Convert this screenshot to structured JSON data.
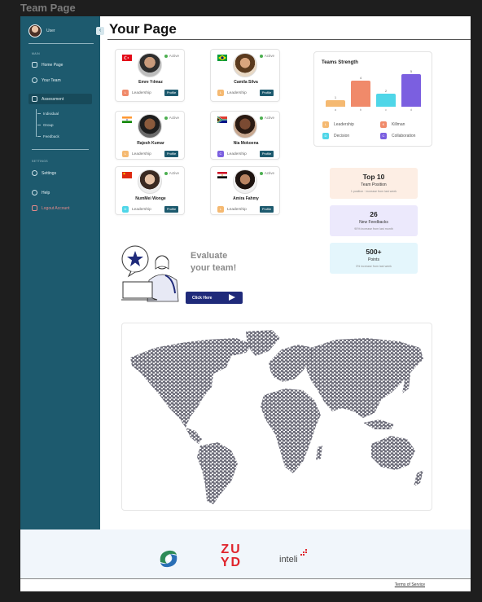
{
  "frame_label": "Team Page",
  "sidebar": {
    "user_name": "User",
    "main_label": "MAIN",
    "settings_label": "SETTINGS",
    "items": [
      {
        "label": "Home Page",
        "icon": "home-icon"
      },
      {
        "label": "Your Team",
        "icon": "team-icon"
      },
      {
        "label": "Assessment",
        "icon": "assessment-icon"
      }
    ],
    "sub_items": [
      "Individual",
      "Group",
      "Feedback"
    ],
    "settings_items": [
      {
        "label": "Settings",
        "icon": "gear-icon"
      },
      {
        "label": "Help",
        "icon": "help-icon"
      },
      {
        "label": "Logout Account",
        "icon": "logout-icon"
      }
    ]
  },
  "page_title": "Your Page",
  "members": [
    {
      "name": "Emre Yılmaz",
      "status": "Active",
      "role": "Leadership",
      "chip": "L",
      "chip_color": "#f08a6a",
      "profile": "Profile",
      "flag": "turkey-flag"
    },
    {
      "name": "Camila Silva",
      "status": "Active",
      "role": "Leadership",
      "chip": "L",
      "chip_color": "#f5b971",
      "profile": "Profile",
      "flag": "brazil-flag"
    },
    {
      "name": "Rajesh Kumar",
      "status": "Active",
      "role": "Leadership",
      "chip": "L",
      "chip_color": "#f5b971",
      "profile": "Profile",
      "flag": "india-flag"
    },
    {
      "name": "Nia Mokoena",
      "status": "Active",
      "role": "Leadership",
      "chip": "C",
      "chip_color": "#7b5fe0",
      "profile": "Profile",
      "flag": "south-africa-flag"
    },
    {
      "name": "NumMei Wonge",
      "status": "Active",
      "role": "Leadership",
      "chip": "D",
      "chip_color": "#4fd6e8",
      "profile": "Profile",
      "flag": "china-flag"
    },
    {
      "name": "Amira Fahmy",
      "status": "Active",
      "role": "Leadership",
      "chip": "L",
      "chip_color": "#f5b971",
      "profile": "Profile",
      "flag": "egypt-flag"
    }
  ],
  "teams_strength": {
    "title": "Teams Strength",
    "legend": [
      {
        "chip": "L",
        "label": "Leadership",
        "color": "#f5b971"
      },
      {
        "chip": "K",
        "label": "Killman",
        "color": "#f08a6a"
      },
      {
        "chip": "D",
        "label": "Decision",
        "color": "#4fd6e8"
      },
      {
        "chip": "C",
        "label": "Collaboration",
        "color": "#7b5fe0"
      }
    ]
  },
  "chart_data": {
    "type": "bar",
    "categories": [
      "a",
      "b",
      "c",
      "d"
    ],
    "values": [
      1,
      4,
      2,
      5
    ],
    "colors": [
      "#f5b971",
      "#f08a6a",
      "#4fd6e8",
      "#7b5fe0"
    ],
    "title": "Teams Strength",
    "ylim": [
      0,
      5
    ]
  },
  "stats": [
    {
      "big": "Top 10",
      "sub": "Team Position",
      "desc": "1 position · increase from last week",
      "bg": "#fdeee4"
    },
    {
      "big": "26",
      "sub": "New Feedbacks",
      "desc": "90% increase from last month",
      "bg": "#ece9fc"
    },
    {
      "big": "500+",
      "sub": "Points",
      "desc": "3% increase from last week",
      "bg": "#e4f6fc"
    }
  ],
  "evaluate": {
    "title_line1": "Evaluate",
    "title_line2": "your team!",
    "button": "Click Here"
  },
  "footer": {
    "zuyd_line1": "ZU",
    "zuyd_line2": "YD",
    "inteli": "inteli",
    "terms": "Terms of Service"
  }
}
